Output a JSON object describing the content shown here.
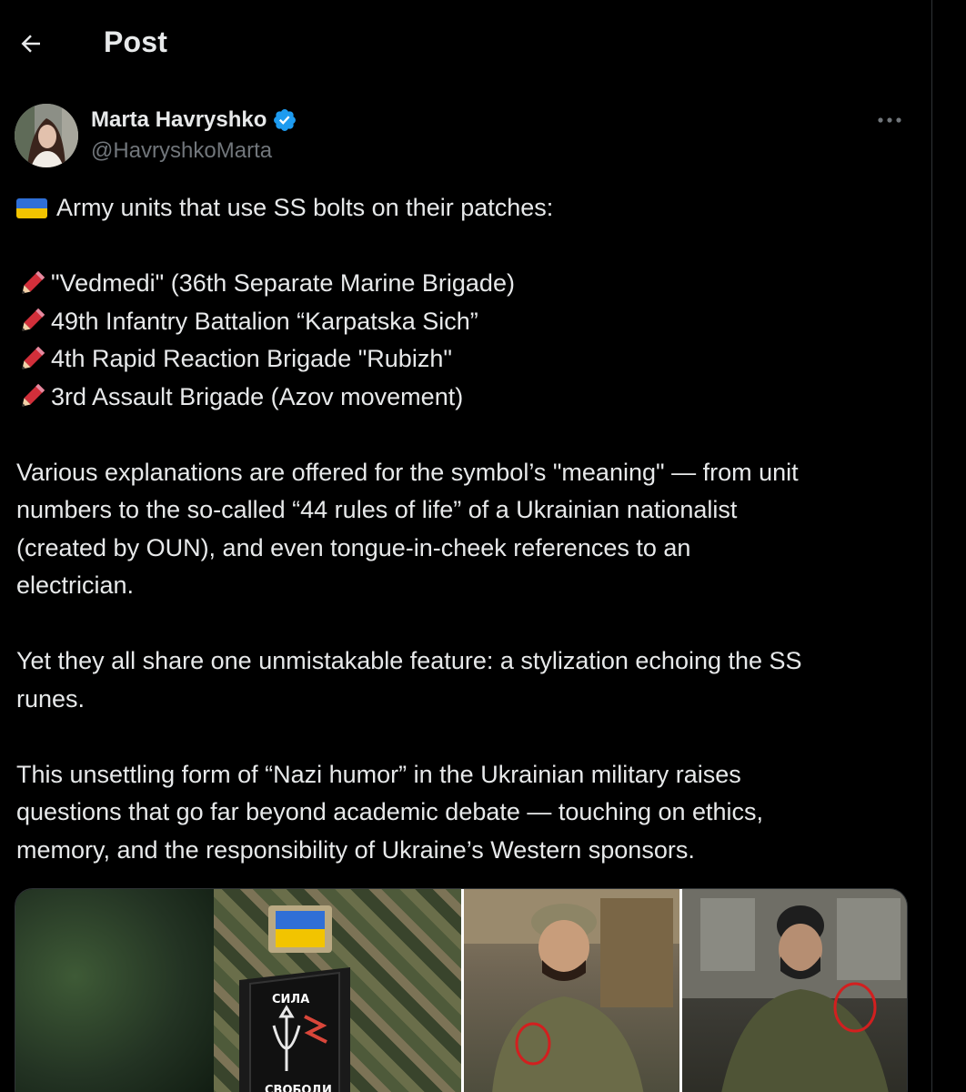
{
  "header": {
    "title": "Post"
  },
  "author": {
    "display_name": "Marta Havryshko",
    "handle": "@HavryshkoMarta"
  },
  "post": {
    "intro": "Army units that use SS bolts on their patches:",
    "units": [
      "\"Vedmedi\" (36th Separate Marine Brigade)",
      "49th Infantry Battalion “Karpatska Sich”",
      "4th Rapid Reaction Brigade \"Rubizh\"",
      "3rd Assault Brigade (Azov movement)"
    ],
    "paragraph1": [
      "Various explanations are offered for the symbol’s \"meaning\" — from unit",
      "numbers to the so-called “44 rules of life” of a Ukrainian nationalist",
      "(created by OUN), and even tongue-in-cheek references to an",
      "electrician."
    ],
    "paragraph2": [
      "Yet they all share one unmistakable feature: a stylization echoing the SS",
      "runes."
    ],
    "paragraph3": [
      "This unsettling form of “Nazi humor” in the Ukrainian military raises",
      "questions that go far beyond academic debate — touching on ethics,",
      "memory, and the responsibility of Ukraine’s Western sponsors."
    ]
  },
  "media": {
    "patch_text_top": "СИЛА",
    "patch_text_bottom": "СВОБОДИ"
  },
  "icons": {
    "back": "arrow-left-icon",
    "verified": "verified-badge-icon",
    "more": "more-dots-icon",
    "flag": "ukraine-flag-emoji",
    "pencil": "red-pencil-emoji"
  },
  "colors": {
    "background": "#000000",
    "text": "#e7e9ea",
    "secondary": "#71767b",
    "verified": "#1d9bf0"
  }
}
